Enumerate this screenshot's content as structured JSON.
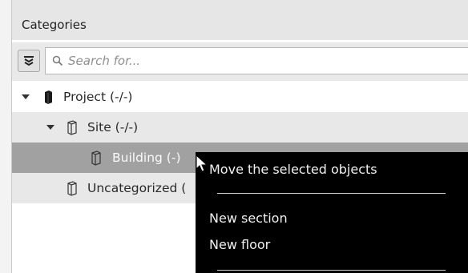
{
  "panel": {
    "title": "Categories",
    "search": {
      "placeholder": "Search for...",
      "value": ""
    }
  },
  "tree": [
    {
      "label": "Project (-/-)",
      "expanded": true,
      "icon": "black-box-icon"
    },
    {
      "label": "Site (-/-)",
      "expanded": true,
      "icon": "outline-box-icon"
    },
    {
      "label": "Building (-)",
      "selected": true,
      "icon": "outline-box-icon"
    },
    {
      "label": "Uncategorized (",
      "icon": "outline-box-icon"
    }
  ],
  "context_menu": {
    "items": [
      "Move the selected objects",
      "New section",
      "New floor"
    ]
  },
  "colors": {
    "header_bg": "#e6e6e6",
    "selected_row": "#a1a1a1",
    "menu_bg": "#000000"
  }
}
